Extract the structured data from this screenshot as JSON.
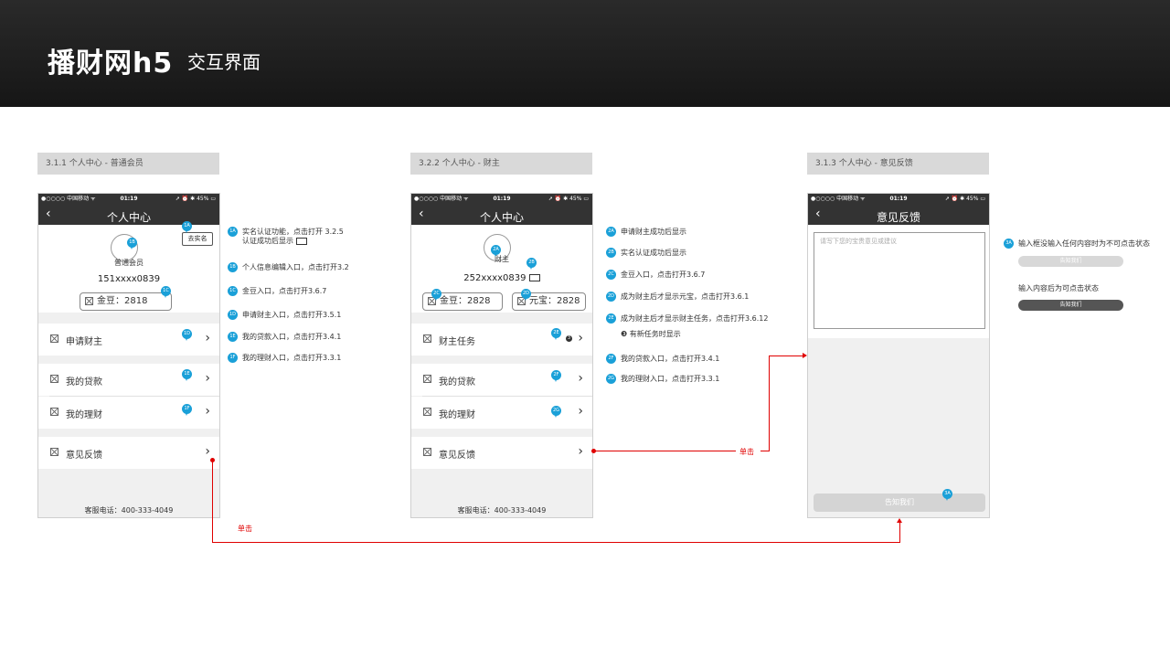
{
  "header": {
    "title": "播财网h5",
    "subtitle": "交互界面"
  },
  "status_bar": {
    "carrier": "●○○○○ 中国移动 ᯤ",
    "time": "01:19",
    "battery": "➚ ⏰ ✱ 45% ▭"
  },
  "screens": {
    "s1": {
      "section_label": "3.1.1 个人中心 - 普通会员",
      "nav_title": "个人中心",
      "realname_button": "去实名",
      "member_type": "普通会员",
      "phone": "151xxxx0839",
      "gold": "金豆：2818",
      "rows": [
        "申请财主",
        "我的贷款",
        "我的理财",
        "意见反馈"
      ],
      "hotline": "客服电话：400-333-4049"
    },
    "s2": {
      "section_label": "3.2.2 个人中心 - 财主",
      "nav_title": "个人中心",
      "member_type": "财主",
      "phone": "252xxxx0839",
      "gold": "金豆：2828",
      "yuanbao": "元宝：2828",
      "rows": [
        "财主任务",
        "我的贷款",
        "我的理财",
        "意见反馈"
      ],
      "task_dot": "3",
      "hotline": "客服电话：400-333-4049"
    },
    "s3": {
      "section_label": "3.1.3 个人中心 - 意见反馈",
      "nav_title": "意见反馈",
      "placeholder": "请写下您的宝贵意见或建议",
      "submit": "告知我们"
    }
  },
  "pins": [
    "1A",
    "1B",
    "1C",
    "1D",
    "1E",
    "1F",
    "2A",
    "2B",
    "2C",
    "2D",
    "2E",
    "2F",
    "2G",
    "3A"
  ],
  "notes1": [
    {
      "badge": "1A",
      "text": "实名认证功能，点击打开 3.2.5",
      "text2": "认证成功后显示"
    },
    {
      "badge": "1B",
      "text": "个人信息编辑入口，点击打开3.2"
    },
    {
      "badge": "1C",
      "text": "金豆入口，点击打开3.6.7"
    },
    {
      "badge": "1D",
      "text": "申请财主入口，点击打开3.5.1"
    },
    {
      "badge": "1E",
      "text": "我的贷款入口，点击打开3.4.1"
    },
    {
      "badge": "1F",
      "text": "我的理财入口，点击打开3.3.1"
    }
  ],
  "notes2": [
    {
      "badge": "2A",
      "text": "申请财主成功后显示"
    },
    {
      "badge": "2B",
      "text": "实名认证成功后显示"
    },
    {
      "badge": "2C",
      "text": "金豆入口，点击打开3.6.7"
    },
    {
      "badge": "2D",
      "text": "成为财主后才显示元宝，点击打开3.6.1"
    },
    {
      "badge": "2E",
      "text": "成为财主后才显示财主任务，点击打开3.6.12",
      "text2": "❸ 有新任务时显示"
    },
    {
      "badge": "2F",
      "text": "我的贷款入口，点击打开3.4.1"
    },
    {
      "badge": "2G",
      "text": "我的理财入口，点击打开3.3.1"
    }
  ],
  "notes3": {
    "badge": "3A",
    "disabled_text": "输入框没输入任何内容时为不可点击状态",
    "enabled_text": "输入内容后为可点击状态",
    "button_label": "告知我们"
  },
  "click_label": "单击",
  "colors": {
    "pin": "#1aa0d8",
    "connector": "#e00000",
    "header_bg": "#1c1c1c"
  }
}
